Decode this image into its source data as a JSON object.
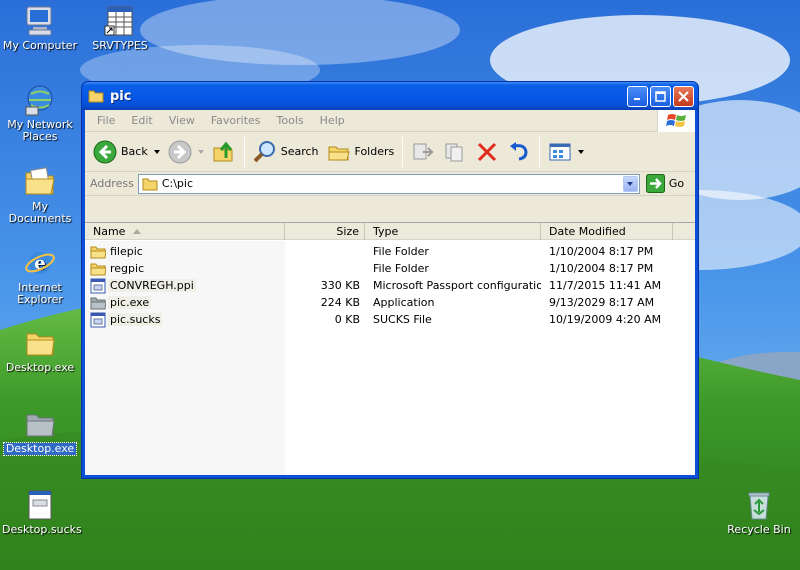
{
  "desktop": {
    "icons": [
      {
        "label": "My Computer"
      },
      {
        "label": "SRVTYPES"
      },
      {
        "label": "My Network Places"
      },
      {
        "label": "My Documents"
      },
      {
        "label": "Internet Explorer"
      },
      {
        "label": "Desktop.exe"
      },
      {
        "label": "Desktop.exe"
      },
      {
        "label": "Desktop.sucks"
      },
      {
        "label": "Recycle Bin"
      }
    ]
  },
  "window": {
    "title": "pic",
    "menu": [
      "File",
      "Edit",
      "View",
      "Favorites",
      "Tools",
      "Help"
    ],
    "toolbar": {
      "back_label": "Back",
      "search_label": "Search",
      "folders_label": "Folders"
    },
    "address": {
      "label": "Address",
      "value": "C:\\pic",
      "go_label": "Go"
    },
    "columns": {
      "name": "Name",
      "size": "Size",
      "type": "Type",
      "date": "Date Modified"
    },
    "files": [
      {
        "name": "filepic",
        "size": "",
        "type": "File Folder",
        "date": "1/10/2004 8:17 PM",
        "icon": "folder-icon"
      },
      {
        "name": "regpic",
        "size": "",
        "type": "File Folder",
        "date": "1/10/2004 8:17 PM",
        "icon": "folder-icon"
      },
      {
        "name": "CONVREGH.ppi",
        "size": "330 KB",
        "type": "Microsoft Passport configuration...",
        "date": "11/7/2015 11:41 AM",
        "icon": "file-icon"
      },
      {
        "name": "pic.exe",
        "size": "224 KB",
        "type": "Application",
        "date": "9/13/2029 8:17 AM",
        "icon": "folder-icon"
      },
      {
        "name": "pic.sucks",
        "size": "0 KB",
        "type": "SUCKS File",
        "date": "10/19/2009 4:20 AM",
        "icon": "file-icon"
      }
    ]
  },
  "colors": {
    "title_blue": "#0550d6",
    "selection": "#316ac5",
    "window_face": "#ece9d8"
  }
}
